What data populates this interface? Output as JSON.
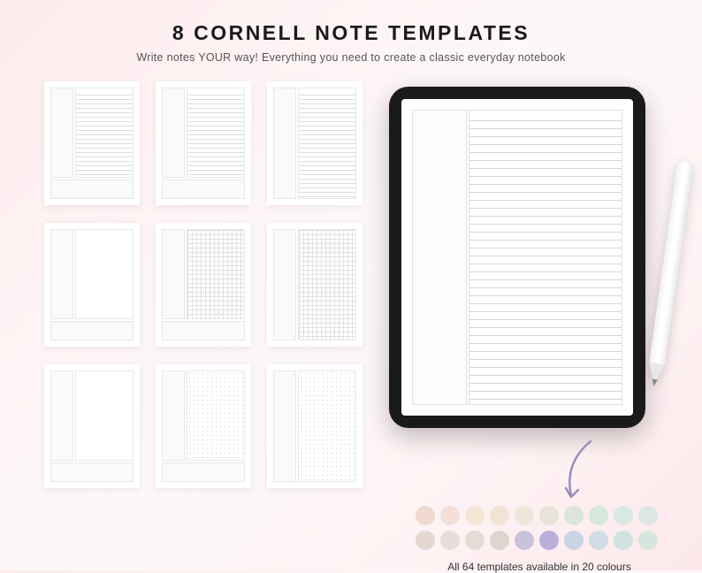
{
  "header": {
    "title": "8 CORNELL NOTE TEMPLATES",
    "subtitle": "Write notes YOUR way! Everything you need to create a classic everyday notebook"
  },
  "grid": {
    "count": 9,
    "templates": [
      {
        "notes_pattern": "lines",
        "summary": true
      },
      {
        "notes_pattern": "lines",
        "summary": true
      },
      {
        "notes_pattern": "lines",
        "summary": false
      },
      {
        "notes_pattern": "blank",
        "summary": true
      },
      {
        "notes_pattern": "grid",
        "summary": true
      },
      {
        "notes_pattern": "grid",
        "summary": false
      },
      {
        "notes_pattern": "blank",
        "summary": true
      },
      {
        "notes_pattern": "dots",
        "summary": true
      },
      {
        "notes_pattern": "dots",
        "summary": false
      }
    ]
  },
  "device": {
    "type": "tablet",
    "pencil_label": "Pencil",
    "screen_template": "cornell-lined"
  },
  "swatches": {
    "caption": "All 64 templates available in 20 colours",
    "colors": [
      "#f0d9d0",
      "#f3dfd8",
      "#f6e6d6",
      "#f0e4d4",
      "#eee6da",
      "#e8e3d9",
      "#dbe5db",
      "#d5e8dc",
      "#d9e8e4",
      "#dde6e5",
      "#e3d7d0",
      "#e8ded9",
      "#e6dcd4",
      "#ded6ce",
      "#c9c2dd",
      "#b9afd8",
      "#c9d4e4",
      "#d1dce8",
      "#cfe2e1",
      "#d4e6dd"
    ]
  }
}
